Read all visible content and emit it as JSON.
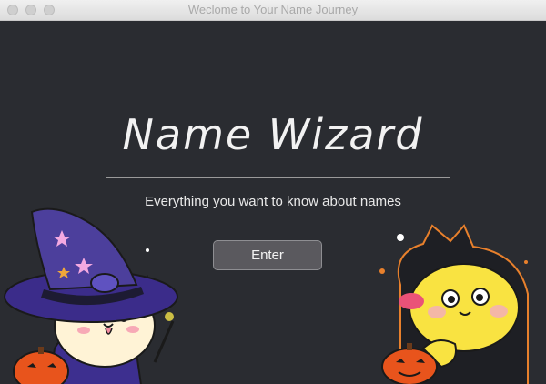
{
  "window": {
    "title": "Weclome to Your Name Journey"
  },
  "main": {
    "title": "Name Wizard",
    "subtitle": "Everything you want to know about names",
    "enter_label": "Enter"
  },
  "colors": {
    "background": "#2a2c31",
    "witch_hat": "#4c3f9c",
    "pumpkin": "#e8541c",
    "yellow_cat": "#f9e341"
  }
}
